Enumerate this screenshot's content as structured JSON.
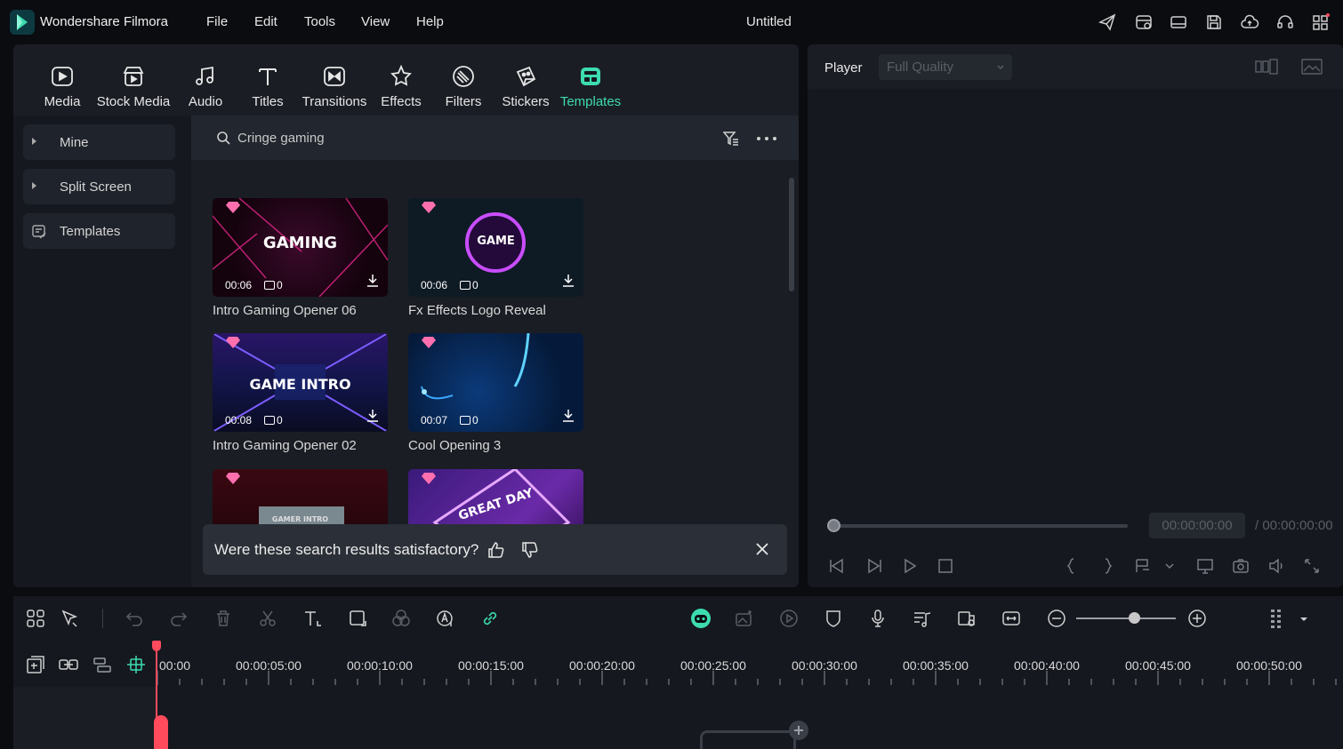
{
  "titlebar": {
    "app_name": "Wondershare Filmora",
    "menu": [
      "File",
      "Edit",
      "Tools",
      "View",
      "Help"
    ],
    "doc_title": "Untitled"
  },
  "toolbar": {
    "tools": [
      {
        "label": "Media",
        "icon": "media-icon"
      },
      {
        "label": "Stock Media",
        "icon": "stock-media-icon"
      },
      {
        "label": "Audio",
        "icon": "audio-icon"
      },
      {
        "label": "Titles",
        "icon": "titles-icon"
      },
      {
        "label": "Transitions",
        "icon": "transitions-icon"
      },
      {
        "label": "Effects",
        "icon": "effects-icon"
      },
      {
        "label": "Filters",
        "icon": "filters-icon"
      },
      {
        "label": "Stickers",
        "icon": "stickers-icon"
      },
      {
        "label": "Templates",
        "icon": "templates-icon",
        "active": true
      }
    ],
    "accent": "#3ddbb0"
  },
  "sidebar": {
    "items": [
      {
        "label": "Mine"
      },
      {
        "label": "Split Screen"
      },
      {
        "label": "Templates"
      }
    ]
  },
  "search": {
    "value": "Cringe gaming"
  },
  "templates": [
    {
      "title": "Intro Gaming Opener 06",
      "duration": "00:06",
      "count": "0",
      "thumb_text": "GAMING"
    },
    {
      "title": "Fx Effects Logo Reveal",
      "duration": "00:06",
      "count": "0",
      "thumb_text": "GAME"
    },
    {
      "title": "Intro Gaming Opener 02",
      "duration": "00:08",
      "count": "0",
      "thumb_text": "GAME INTRO"
    },
    {
      "title": "Cool Opening 3",
      "duration": "00:07",
      "count": "0",
      "thumb_text": ""
    },
    {
      "title": "",
      "duration": "",
      "count": "",
      "thumb_text": "GAMER INTRO"
    },
    {
      "title": "",
      "duration": "",
      "count": "",
      "thumb_text": "GREAT DAY"
    }
  ],
  "feedback": {
    "question": "Were these search results satisfactory?"
  },
  "player": {
    "label": "Player",
    "quality": "Full Quality",
    "timecode": "00:00:00:00",
    "total": "/ 00:00:00:00"
  },
  "timeline": {
    "ticks": [
      "00:00",
      "00:00:05:00",
      "00:00:10:00",
      "00:00:15:00",
      "00:00:20:00",
      "00:00:25:00",
      "00:00:30:00",
      "00:00:35:00",
      "00:00:40:00",
      "00:00:45:00",
      "00:00:50:00"
    ]
  }
}
